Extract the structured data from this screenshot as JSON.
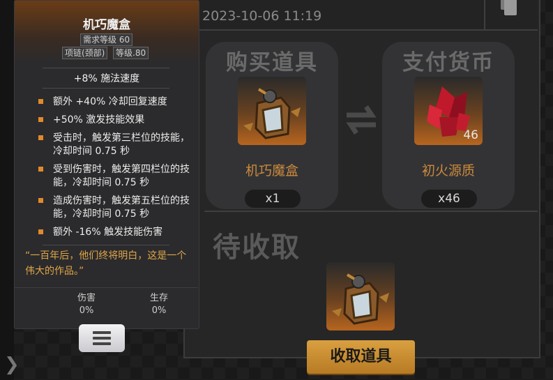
{
  "tooltip": {
    "item_name": "机巧魔盒",
    "required_level": "需求等级 60",
    "slot": "项链(颈部)",
    "item_level": "等级.80",
    "main_stat": "+8% 施法速度",
    "effects": [
      "额外 +40% 冷却回复速度",
      "+50% 激发技能效果",
      "受击时，触发第三栏位的技能，冷却时间 0.75 秒",
      "受到伤害时，触发第四栏位的技能，冷却时间 0.75 秒",
      "造成伤害时，触发第五栏位的技能，冷却时间 0.75 秒",
      "额外 -16% 触发技能伤害"
    ],
    "flavor": "“一百年后，他们终将明白，这是一个伟大的作品。”",
    "damage_label": "伤害",
    "damage_value": "0%",
    "survival_label": "生存",
    "survival_value": "0%"
  },
  "order": {
    "date": "2023-10-06 11:19"
  },
  "buy": {
    "title": "购买道具",
    "item_name": "机巧魔盒",
    "quantity": "x1"
  },
  "pay": {
    "title": "支付货币",
    "currency_name": "初火源质",
    "quantity": "x46",
    "badge_count": "46"
  },
  "pending": {
    "title": "待收取",
    "claim_label": "收取道具"
  },
  "colors": {
    "accent_gold": "#d9a040",
    "item_name_orange": "#cc8a3c",
    "effect_bullet": "#e08a2a"
  }
}
